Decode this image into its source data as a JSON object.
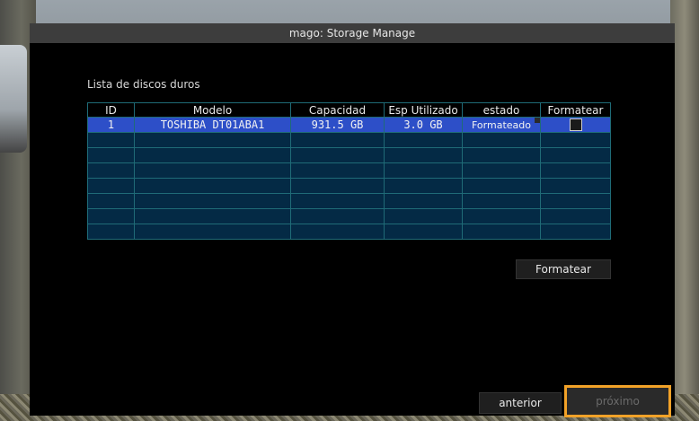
{
  "window": {
    "title": "mago: Storage Manage"
  },
  "disk_list": {
    "label": "Lista de discos duros",
    "columns": [
      "ID",
      "Modelo",
      "Capacidad",
      "Esp Utilizado",
      "estado",
      "Formatear"
    ],
    "rows": [
      {
        "id": "1",
        "model": "TOSHIBA DT01ABA1",
        "capacity": "931.5 GB",
        "used": "3.0 GB",
        "state": "Formateado",
        "format_checked": false
      }
    ],
    "empty_rows": 7
  },
  "buttons": {
    "format": "Formatear",
    "previous": "anterior",
    "next": "próximo"
  },
  "colors": {
    "selected_row": "#2d4fc8",
    "empty_row": "#042a45",
    "grid_border": "#1f6b77",
    "highlight_outline": "#f2a228"
  }
}
